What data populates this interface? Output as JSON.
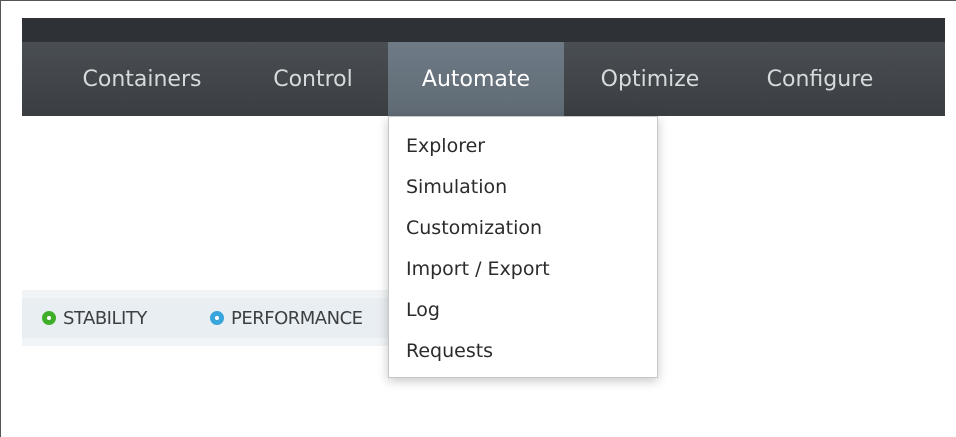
{
  "nav": {
    "items": [
      {
        "label": "Containers"
      },
      {
        "label": "Control"
      },
      {
        "label": "Automate"
      },
      {
        "label": "Optimize"
      },
      {
        "label": "Configure"
      }
    ],
    "active": "Automate"
  },
  "dropdown": {
    "items": [
      {
        "label": "Explorer"
      },
      {
        "label": "Simulation"
      },
      {
        "label": "Customization"
      },
      {
        "label": "Import / Export"
      },
      {
        "label": "Log"
      },
      {
        "label": "Requests"
      }
    ]
  },
  "status": {
    "items": [
      {
        "label": "STABILITY",
        "color": "#3fae29",
        "icon": "status-ring-icon"
      },
      {
        "label": "PERFORMANCE",
        "color": "#39a5dc",
        "icon": "status-ring-icon"
      }
    ]
  }
}
